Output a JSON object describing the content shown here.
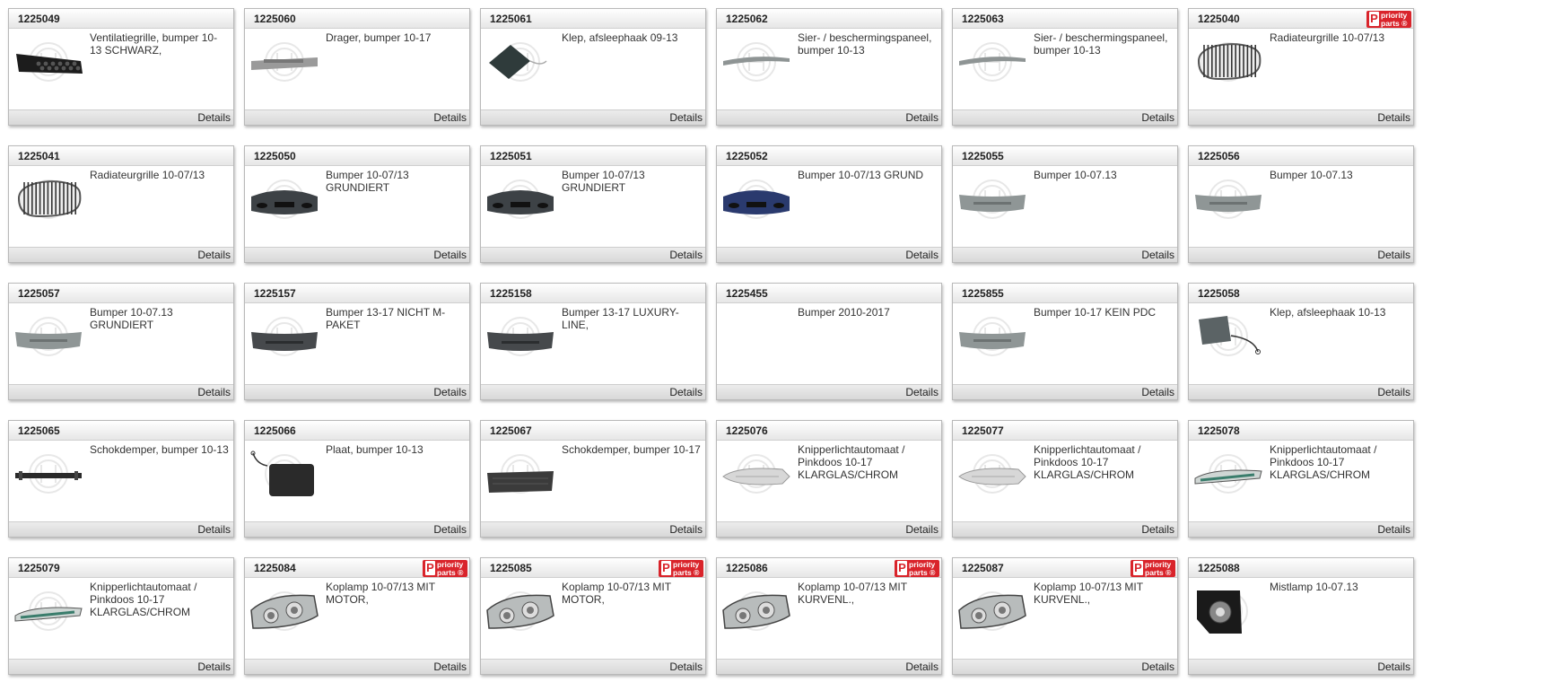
{
  "ui": {
    "details_label": "Details",
    "badge": {
      "mark": "P",
      "text": "priority\nparts ®",
      "color": "#d9242b"
    }
  },
  "products": [
    {
      "id": "1225049",
      "desc": "Ventilatiegrille, bumper 10-13 SCHWARZ,",
      "part": "vent-grille",
      "priority": false
    },
    {
      "id": "1225060",
      "desc": "Drager, bumper 10-17",
      "part": "bumper-carrier",
      "priority": false
    },
    {
      "id": "1225061",
      "desc": "Klep, afsleephaak 09-13",
      "part": "tow-flap",
      "priority": false
    },
    {
      "id": "1225062",
      "desc": "Sier- / beschermingspaneel, bumper 10-13",
      "part": "trim-strip",
      "priority": false
    },
    {
      "id": "1225063",
      "desc": "Sier- / beschermingspaneel, bumper 10-13",
      "part": "trim-strip",
      "priority": false
    },
    {
      "id": "1225040",
      "desc": "Radiateurgrille 10-07/13",
      "part": "kidney-grille",
      "priority": true
    },
    {
      "id": "1225041",
      "desc": "Radiateurgrille 10-07/13",
      "part": "kidney-grille",
      "priority": false
    },
    {
      "id": "1225050",
      "desc": "Bumper 10-07/13 GRUNDIERT",
      "part": "front-bumper-dark",
      "priority": false
    },
    {
      "id": "1225051",
      "desc": "Bumper 10-07/13 GRUNDIERT",
      "part": "front-bumper-dark",
      "priority": false
    },
    {
      "id": "1225052",
      "desc": "Bumper 10-07/13 GRUND",
      "part": "front-bumper-blue",
      "priority": false
    },
    {
      "id": "1225055",
      "desc": "Bumper 10-07.13",
      "part": "rear-bumper-grey",
      "priority": false
    },
    {
      "id": "1225056",
      "desc": "Bumper 10-07.13",
      "part": "rear-bumper-grey",
      "priority": false
    },
    {
      "id": "1225057",
      "desc": "Bumper 10-07.13 GRUNDIERT",
      "part": "rear-bumper-grey",
      "priority": false
    },
    {
      "id": "1225157",
      "desc": "Bumper 13-17 NICHT M-PAKET",
      "part": "rear-bumper-dark",
      "priority": false
    },
    {
      "id": "1225158",
      "desc": "Bumper 13-17 LUXURY-LINE,",
      "part": "rear-bumper-dark",
      "priority": false
    },
    {
      "id": "1225455",
      "desc": "Bumper 2010-2017",
      "part": "none",
      "priority": false
    },
    {
      "id": "1225855",
      "desc": "Bumper 10-17 KEIN PDC",
      "part": "rear-bumper-grey",
      "priority": false
    },
    {
      "id": "1225058",
      "desc": "Klep, afsleephaak 10-13",
      "part": "tow-cap",
      "priority": false
    },
    {
      "id": "1225065",
      "desc": "Schokdemper, bumper 10-13",
      "part": "impact-bar",
      "priority": false
    },
    {
      "id": "1225066",
      "desc": "Plaat, bumper 10-13",
      "part": "plate",
      "priority": false
    },
    {
      "id": "1225067",
      "desc": "Schokdemper, bumper 10-17",
      "part": "absorber",
      "priority": false
    },
    {
      "id": "1225076",
      "desc": "Knipperlichtautomaat / Pinkdoos 10-17 KLARGLAS/CHROM",
      "part": "indicator-clear",
      "priority": false
    },
    {
      "id": "1225077",
      "desc": "Knipperlichtautomaat / Pinkdoos 10-17 KLARGLAS/CHROM",
      "part": "indicator-clear",
      "priority": false
    },
    {
      "id": "1225078",
      "desc": "Knipperlichtautomaat / Pinkdoos 10-17 KLARGLAS/CHROM",
      "part": "indicator-green",
      "priority": false
    },
    {
      "id": "1225079",
      "desc": "Knipperlichtautomaat / Pinkdoos 10-17 KLARGLAS/CHROM",
      "part": "indicator-green",
      "priority": false
    },
    {
      "id": "1225084",
      "desc": "Koplamp 10-07/13 MIT MOTOR,",
      "part": "headlamp",
      "priority": true
    },
    {
      "id": "1225085",
      "desc": "Koplamp 10-07/13 MIT MOTOR,",
      "part": "headlamp",
      "priority": true
    },
    {
      "id": "1225086",
      "desc": "Koplamp 10-07/13 MIT KURVENL.,",
      "part": "headlamp",
      "priority": true
    },
    {
      "id": "1225087",
      "desc": "Koplamp 10-07/13 MIT KURVENL.,",
      "part": "headlamp",
      "priority": true
    },
    {
      "id": "1225088",
      "desc": "Mistlamp 10-07.13",
      "part": "fog-lamp",
      "priority": false
    }
  ]
}
